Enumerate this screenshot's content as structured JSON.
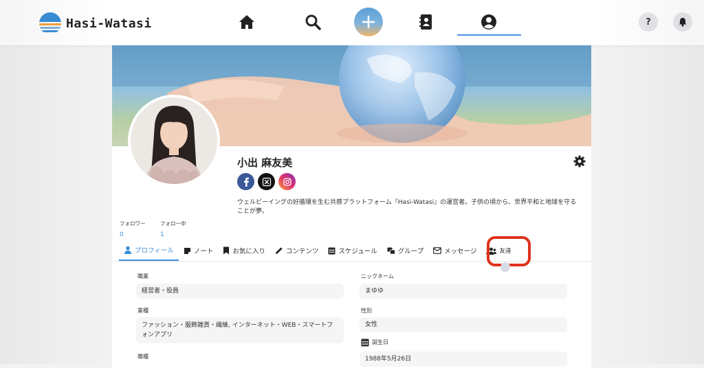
{
  "app": {
    "logo_text": "Hasi-Watasi"
  },
  "topbar": {
    "help_label": "?",
    "nav": [
      "home-icon",
      "search-icon",
      "plus-icon",
      "contacts-icon",
      "account-icon"
    ],
    "active_nav": "account"
  },
  "profile": {
    "name": "小出 麻友美",
    "bio": "ウェルビーイングの好循環を生む共感プラットフォーム『Hasi-Watasi』の運営者。子供の頃から、世界平和と地球を守ることが夢。",
    "followers_label": "フォロワー",
    "followers_count": "0",
    "following_label": "フォロー中",
    "following_count": "1",
    "socials": [
      "facebook-icon",
      "x-icon",
      "instagram-icon"
    ]
  },
  "tabs": [
    {
      "label": "プロフィール",
      "icon": "user-icon"
    },
    {
      "label": "ノート",
      "icon": "note-icon"
    },
    {
      "label": "お気に入り",
      "icon": "bookmark-icon"
    },
    {
      "label": "コンテンツ",
      "icon": "pencil-icon"
    },
    {
      "label": "スケジュール",
      "icon": "calendar-icon"
    },
    {
      "label": "グループ",
      "icon": "group-icon"
    },
    {
      "label": "メッセージ",
      "icon": "envelope-icon"
    },
    {
      "label": "友達",
      "icon": "friends-icon"
    }
  ],
  "fields": {
    "occupation_label": "職業",
    "occupation_value": "経営者・役員",
    "industry_label": "業種",
    "industry_value": "ファッション・服飾雑貨・繊維, インターネット・WEB・スマートフォンアプリ",
    "position_label": "職種",
    "nickname_label": "ニックネーム",
    "nickname_value": "まゆゆ",
    "gender_label": "性別",
    "gender_value": "女性",
    "birthday_label": "誕生日",
    "birthday_value": "1988年5月26日"
  },
  "colors": {
    "accent": "#3b8fd9",
    "highlight": "#e0321c"
  }
}
